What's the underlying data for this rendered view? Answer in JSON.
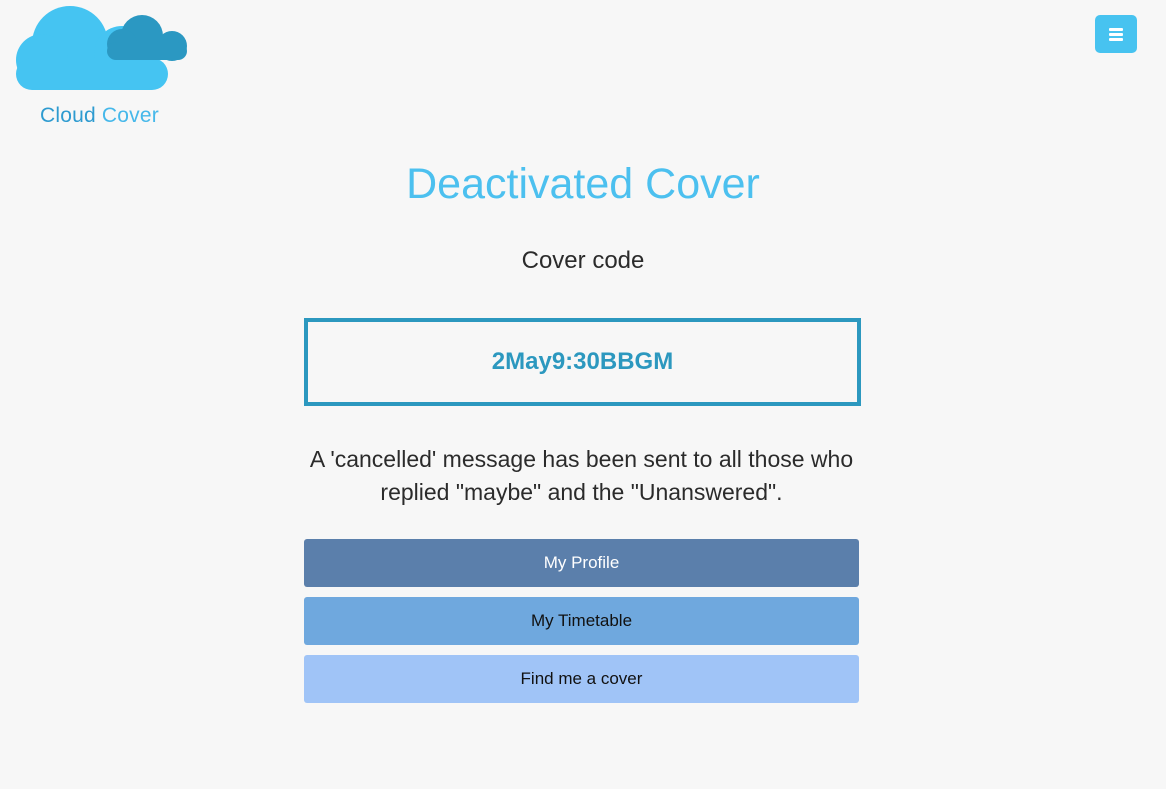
{
  "logo": {
    "word1": "Cloud",
    "word2": "Cover",
    "icon": "cloud-logo-icon"
  },
  "menu": {
    "icon": "hamburger-menu-icon",
    "color": "#47c3f0"
  },
  "main": {
    "title": "Deactivated Cover",
    "subtitle": "Cover code",
    "code": "2May9:30BBGM",
    "message": "A 'cancelled' message has been sent to all those who replied \"maybe\" and the \"Unanswered\"."
  },
  "buttons": {
    "profile": "My Profile",
    "timetable": "My Timetable",
    "find_cover": "Find me a cover"
  },
  "colors": {
    "accent": "#4cc0ef",
    "code_border": "#2c98bf",
    "profile_button": "#5b7fab",
    "timetable_button": "#6fa8de",
    "find_button": "#a0c4f7"
  }
}
